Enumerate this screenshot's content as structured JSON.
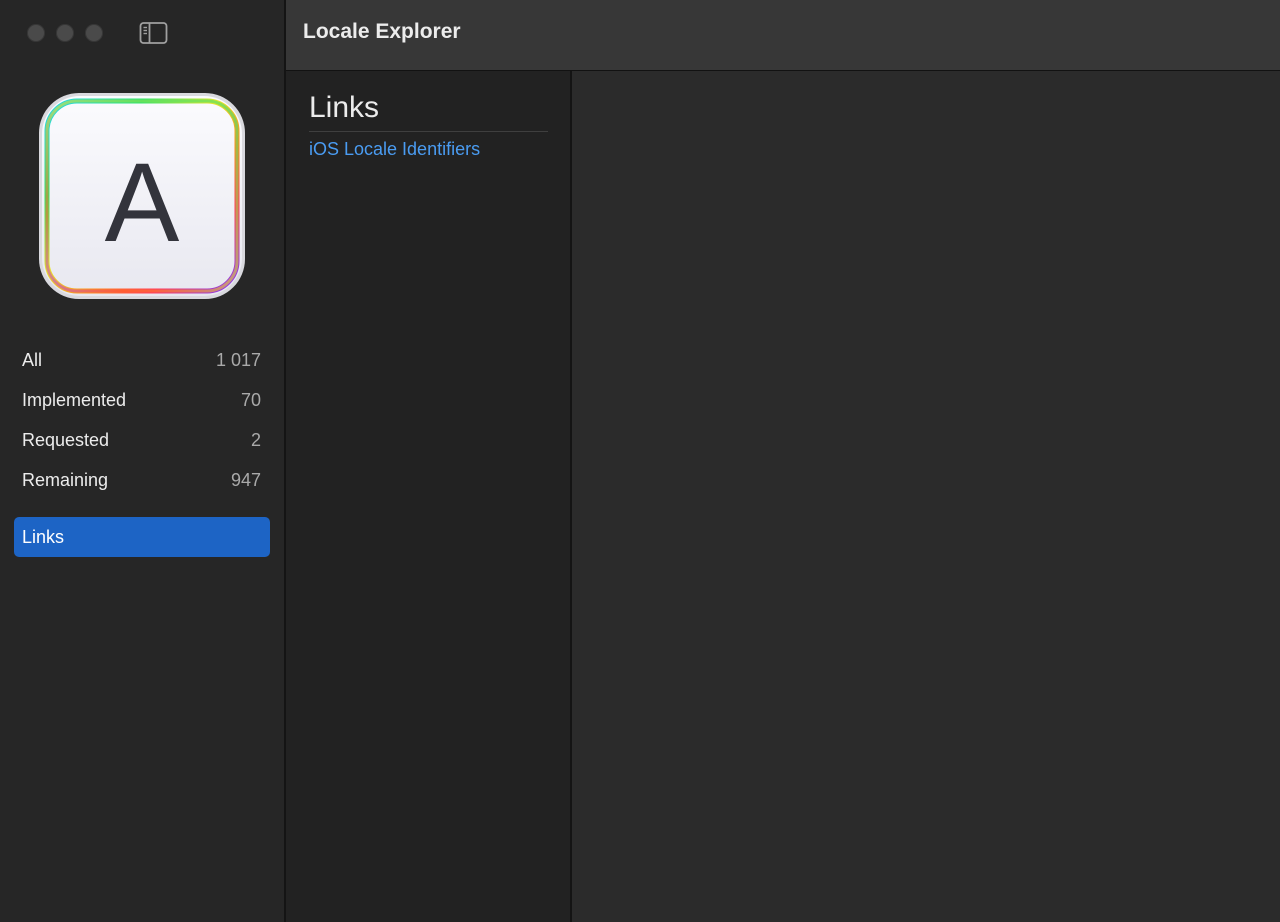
{
  "window": {
    "title": "Locale Explorer"
  },
  "sidebar": {
    "app_icon_letter": "A",
    "items": [
      {
        "label": "All",
        "count": "1 017"
      },
      {
        "label": "Implemented",
        "count": "70"
      },
      {
        "label": "Requested",
        "count": "2"
      },
      {
        "label": "Remaining",
        "count": "947"
      }
    ],
    "selected_item": {
      "label": "Links"
    }
  },
  "content": {
    "heading": "Links",
    "links": [
      {
        "label": "iOS Locale Identifiers"
      }
    ]
  },
  "icons": {
    "traffic_lights": [
      "close-button",
      "minimize-button",
      "zoom-button"
    ],
    "sidebar_toggle": "sidebar-toggle-icon"
  },
  "colors": {
    "accent": "#1d64c5",
    "link": "#4a9cf2"
  }
}
